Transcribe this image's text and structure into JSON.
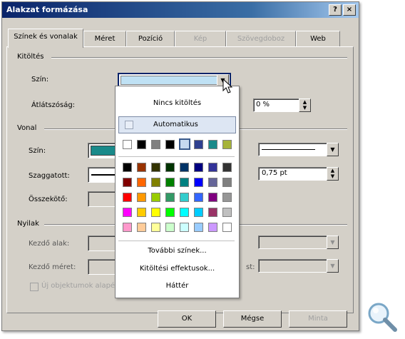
{
  "dialog": {
    "title": "Alakzat formázása",
    "help_label": "?",
    "close_label": "×",
    "tabs": [
      "Színek és vonalak",
      "Méret",
      "Pozíció",
      "Kép",
      "Szövegdoboz",
      "Web"
    ],
    "active_tab": "Színek és vonalak"
  },
  "fill": {
    "section": "Kitöltés",
    "color_label": "Szín:",
    "transparency_label": "Átlátszóság:",
    "transparency_value": "0 %",
    "selected_color": "#bfe1f4"
  },
  "line": {
    "section": "Vonal",
    "color_label": "Szín:",
    "color_value": "#1a8a8a",
    "dash_label": "Szaggatott:",
    "connector_label": "Összekötő:",
    "weight_value": "0,75 pt"
  },
  "arrows": {
    "section": "Nyilak",
    "begin_style_label": "Kezdő alak:",
    "begin_size_label": "Kezdő méret:",
    "end_size_label": "st:",
    "default_checkbox_label": "Új objektumok alapért..."
  },
  "buttons": {
    "ok": "OK",
    "cancel": "Mégse",
    "preview": "Minta"
  },
  "popup": {
    "no_fill": "Nincs kitöltés",
    "automatic": "Automatikus",
    "recent_colors": [
      "#ffffff",
      "#000000",
      "#808080",
      "#000000",
      "#c6d9f0",
      "#2e3f8f",
      "#1a8a8a",
      "#a6b33a"
    ],
    "palette": [
      [
        "#000000",
        "#993300",
        "#333300",
        "#003300",
        "#003366",
        "#000080",
        "#333399",
        "#333333"
      ],
      [
        "#800000",
        "#ff6600",
        "#808000",
        "#008000",
        "#008080",
        "#0000ff",
        "#666699",
        "#808080"
      ],
      [
        "#ff0000",
        "#ff9900",
        "#99cc00",
        "#339966",
        "#33cccc",
        "#3366ff",
        "#800080",
        "#969696"
      ],
      [
        "#ff00ff",
        "#ffcc00",
        "#ffff00",
        "#00ff00",
        "#00ffff",
        "#00ccff",
        "#993366",
        "#c0c0c0"
      ],
      [
        "#ff99cc",
        "#ffcc99",
        "#ffff99",
        "#ccffcc",
        "#ccffff",
        "#99ccff",
        "#cc99ff",
        "#ffffff"
      ]
    ],
    "more_colors": "További színek...",
    "fill_effects": "Kitöltési effektusok...",
    "background": "Háttér"
  },
  "icons": {
    "magnifier": "magnifier-icon",
    "cursor": "mouse-cursor-icon"
  }
}
